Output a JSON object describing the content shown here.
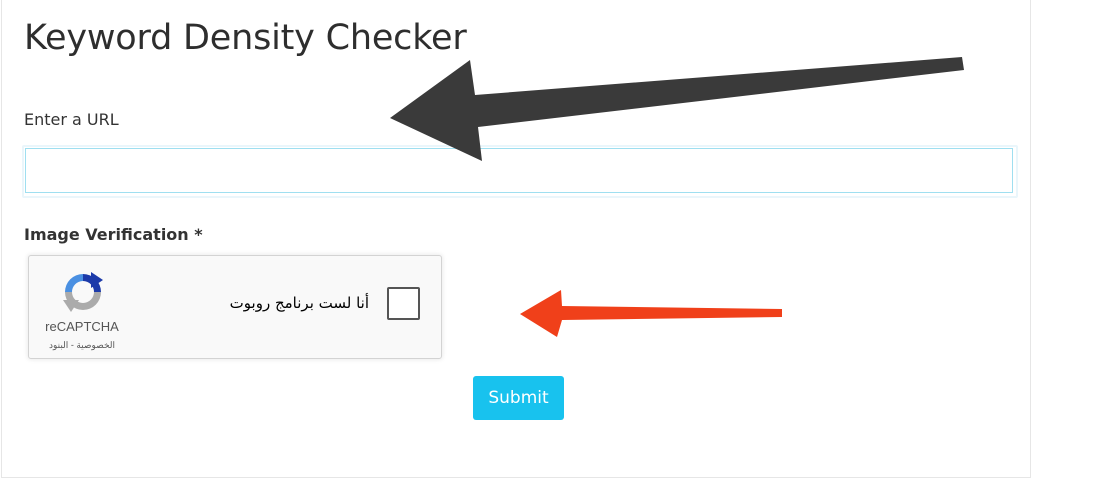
{
  "page": {
    "title": "Keyword Density Checker"
  },
  "url_field": {
    "label": "Enter a URL",
    "value": "",
    "placeholder": ""
  },
  "verification": {
    "label": "Image Verification *"
  },
  "recaptcha": {
    "checkbox_text": "أنا لست برنامج روبوت",
    "brand": "reCAPTCHA",
    "privacy_link": "الخصوصية",
    "separator": " - ",
    "terms_link": "البنود",
    "logo_icon": "recaptcha-logo-icon"
  },
  "submit": {
    "label": "Submit"
  },
  "annotations": {
    "black_arrow_color": "#3a3a3a",
    "red_arrow_color": "#f0401a"
  },
  "colors": {
    "accent": "#18c2ee",
    "input_border": "#9fdff0",
    "title_text": "#2e2e2e"
  }
}
